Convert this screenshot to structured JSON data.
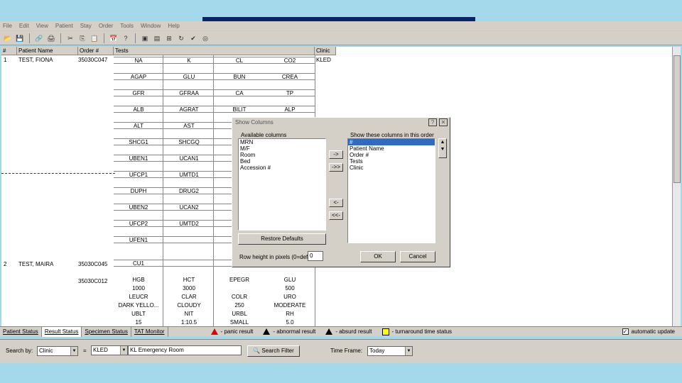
{
  "menu": [
    "File",
    "Edit",
    "View",
    "Patient",
    "Stay",
    "Order",
    "Tools",
    "Window",
    "Help"
  ],
  "toolbar_icons": [
    "open-icon",
    "save-icon",
    "link-icon",
    "print-icon",
    "cut-icon",
    "copy-icon",
    "paste-icon",
    "calendar-icon",
    "help-icon",
    "window1-icon",
    "window2-icon",
    "network-icon",
    "refresh-icon",
    "check-icon",
    "globe-icon"
  ],
  "grid": {
    "headers": {
      "num": "#",
      "patient": "Patient Name",
      "order": "Order #",
      "tests": "Tests",
      "clinic": "Clinic"
    },
    "rows": [
      {
        "num": "1",
        "patient": "TEST, FIONA",
        "order": "35030C047",
        "clinic": "KLED"
      },
      {
        "num": "2",
        "patient": "TEST, MAIRA",
        "order": "35030C045",
        "clinic": ""
      },
      {
        "order2": "35030C012"
      }
    ],
    "tests": [
      [
        "NA",
        "K",
        "CL",
        "CO2"
      ],
      [
        "AGAP",
        "GLU",
        "BUN",
        "CREA"
      ],
      [
        "GFR",
        "GFRAA",
        "CA",
        "TP"
      ],
      [
        "ALB",
        "AGRAT",
        "BILIT",
        "ALP"
      ],
      [
        "ALT",
        "AST",
        "",
        ""
      ],
      [
        "SHCG1",
        "SHCGQ",
        "",
        ""
      ],
      [
        "UBEN1",
        "UCAN1",
        "",
        ""
      ],
      [
        "UFCP1",
        "UMTD1",
        "",
        ""
      ],
      [
        "DUPH",
        "DRUG2",
        "",
        ""
      ],
      [
        "UBEN2",
        "UCAN2",
        "",
        ""
      ],
      [
        "UFCP2",
        "UMTD2",
        "",
        ""
      ],
      [
        "UFEN1",
        "",
        "",
        ""
      ]
    ],
    "row2_test": "CU1",
    "row3_tests": [
      [
        "HGB",
        "HCT",
        "EPEGR",
        "GLU"
      ],
      [
        "1000",
        "3000",
        "",
        "500"
      ],
      [
        "LEUCR",
        "CLAR",
        "COLR",
        "URO"
      ],
      [
        "DARK YELLO...",
        "CLOUDY",
        "250",
        "MODERATE"
      ],
      [
        "UBLT",
        "NIT",
        "URBL",
        "RH"
      ],
      [
        "15",
        "1:10.5",
        "SMALL",
        "5.0"
      ]
    ]
  },
  "tabs": [
    "Patient Status",
    "Result Status",
    "Specimen Status",
    "TAT Monitor"
  ],
  "legend": [
    {
      "label": "- panic result",
      "color": "#e00000"
    },
    {
      "label": "- abnormal result",
      "color": "#ffff00"
    },
    {
      "label": "- absurd result",
      "color": "#000000"
    },
    {
      "label": "- turnaround time status",
      "color": "#ffff00"
    }
  ],
  "auto_update": "automatic update",
  "search": {
    "search_by_label": "Search by:",
    "search_by_value": "Clinic",
    "equals": "=",
    "code": "KLED",
    "description": "KL Emergency Room",
    "search_button": "Search Filter",
    "time_frame_label": "Time Frame:",
    "time_frame_value": "Today"
  },
  "dialog": {
    "title": "Show Columns",
    "available_label": "Available columns",
    "available": [
      "MRN",
      "M/F",
      "Room",
      "Bed",
      "Accession #"
    ],
    "shown_label": "Show these columns in this order",
    "shown": [
      "#",
      "Patient Name",
      "Order #",
      "Tests",
      "Clinic"
    ],
    "move_right": "->",
    "move_all_right": "->>",
    "move_left": "<-",
    "move_all_left": "<<-",
    "restore": "Restore Defaults",
    "row_height_label": "Row height in pixels (0=def):",
    "row_height_value": "0",
    "ok": "OK",
    "cancel": "Cancel"
  }
}
